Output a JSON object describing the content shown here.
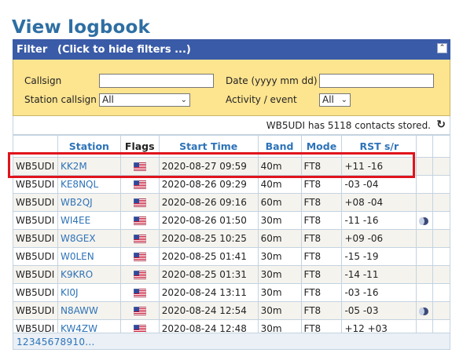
{
  "page": {
    "title": "View logbook"
  },
  "filter": {
    "label": "Filter",
    "hint": "(Click to hide filters ...)",
    "collapse_icon": "collapse-icon",
    "callsign_label": "Callsign",
    "callsign_value": "",
    "date_label": "Date (yyyy mm dd)",
    "date_value": "",
    "station_callsign_label": "Station callsign",
    "station_callsign_selected": "All",
    "activity_label": "Activity / event",
    "activity_selected": "All"
  },
  "summary": {
    "text": "WB5UDI has 5118 contacts stored.",
    "refresh_icon": "refresh-icon"
  },
  "table": {
    "headers": {
      "station": "Station",
      "flags": "Flags",
      "start_time": "Start Time",
      "band": "Band",
      "mode": "Mode",
      "rst": "RST s/r"
    },
    "rows": [
      {
        "call": "WB5UDI",
        "station": "KK2M",
        "start": "2020-08-27 09:59",
        "band": "40m",
        "mode": "FT8",
        "rst": "+11 -16",
        "icon": ""
      },
      {
        "call": "WB5UDI",
        "station": "KE8NQL",
        "start": "2020-08-26 09:29",
        "band": "40m",
        "mode": "FT8",
        "rst": "-03 -04",
        "icon": ""
      },
      {
        "call": "WB5UDI",
        "station": "WB2QJ",
        "start": "2020-08-26 09:16",
        "band": "60m",
        "mode": "FT8",
        "rst": "+08 -04",
        "icon": ""
      },
      {
        "call": "WB5UDI",
        "station": "WI4EE",
        "start": "2020-08-26 01:50",
        "band": "30m",
        "mode": "FT8",
        "rst": "-11 -16",
        "icon": "moon-icon"
      },
      {
        "call": "WB5UDI",
        "station": "W8GEX",
        "start": "2020-08-25 10:25",
        "band": "60m",
        "mode": "FT8",
        "rst": "+09 -06",
        "icon": ""
      },
      {
        "call": "WB5UDI",
        "station": "W0LEN",
        "start": "2020-08-25 01:41",
        "band": "30m",
        "mode": "FT8",
        "rst": "-15 -19",
        "icon": ""
      },
      {
        "call": "WB5UDI",
        "station": "K9KRO",
        "start": "2020-08-25 01:31",
        "band": "30m",
        "mode": "FT8",
        "rst": "-14 -11",
        "icon": ""
      },
      {
        "call": "WB5UDI",
        "station": "KI0J",
        "start": "2020-08-24 13:11",
        "band": "30m",
        "mode": "FT8",
        "rst": "-03 -16",
        "icon": ""
      },
      {
        "call": "WB5UDI",
        "station": "N8AWW",
        "start": "2020-08-24 12:54",
        "band": "30m",
        "mode": "FT8",
        "rst": "-05 -03",
        "icon": "moon-icon"
      },
      {
        "call": "WB5UDI",
        "station": "KW4ZW",
        "start": "2020-08-24 12:48",
        "band": "30m",
        "mode": "FT8",
        "rst": "+12 +03",
        "icon": ""
      }
    ]
  },
  "pager": {
    "pages": "12345678910..."
  },
  "colors": {
    "accent": "#2e73b8",
    "filter_bar": "#3a5ba7",
    "filter_panel": "#fde48f",
    "highlight": "#e0141c"
  }
}
